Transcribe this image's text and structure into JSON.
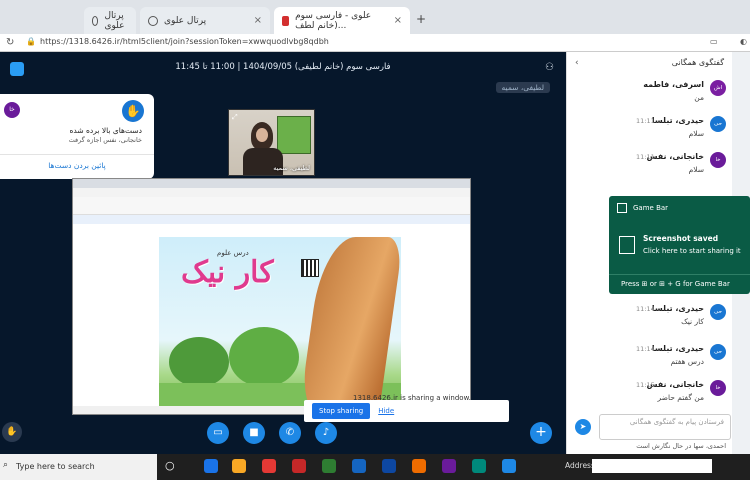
{
  "browser": {
    "tabs": [
      {
        "label": "پرتال علوی"
      },
      {
        "label": "پرتال علوی"
      },
      {
        "label": "علوی - فارسی سوم (خانم لطف..."
      }
    ],
    "url": "https://1318.6426.ir/html5client/join?sessionToken=xwwquodlvbg8qdbh"
  },
  "meeting": {
    "title": "فارسی سوم (خانم لطیفی) 1404/09/05 | 11:00 تا 11:45",
    "presenter_label": "لطیفی، سمیه",
    "hand_panel": {
      "avatar": "خا",
      "title": "دست‌های بالا برده شده",
      "subtitle": "خانجانی، نفس اجازه گرفت",
      "lower_button": "پائین بردن دست‌ها"
    },
    "webcam_name": "لطیفی، سمیه",
    "shared_window": {
      "page_title": "کار نیک",
      "page_subtitle": "درس علوم"
    },
    "sharing_bar": {
      "message": "1318.6426.ir is sharing a window.",
      "stop_label": "Stop sharing",
      "hide_label": "Hide"
    }
  },
  "chat": {
    "title": "گفتگوی همگانی",
    "messages": [
      {
        "avatar": "اش",
        "name": "اسرفی، فاطمه",
        "time": "",
        "text": "من",
        "color": "#7b1fa2"
      },
      {
        "avatar": "حی",
        "name": "حیدری، تبلسا",
        "time": "11:11",
        "text": "سلام",
        "color": "#1976d2"
      },
      {
        "avatar": "خا",
        "name": "خانجانی، نفس",
        "time": "11:11",
        "text": "سلام",
        "color": "#6a1b9a"
      },
      {
        "avatar": "حی",
        "name": "حیدری، تبلسا",
        "time": "11:14",
        "text": "کار نیک",
        "color": "#1976d2"
      },
      {
        "avatar": "حی",
        "name": "حیدری، تبلسا",
        "time": "11:14",
        "text": "درس هفتم",
        "color": "#1976d2"
      },
      {
        "avatar": "خا",
        "name": "خانجانی، نفس",
        "time": "11:15",
        "text": "من گفتم حاضر",
        "color": "#6a1b9a"
      }
    ],
    "input_placeholder": "فرستادن پیام به گفتگوی همگانی",
    "typing": "احمدی، سها در حال نگارش است"
  },
  "gamebar": {
    "title": "Game Bar",
    "saved": "Screenshot saved",
    "share": "Click here to start sharing it",
    "hint": "Press ⊞ or ⊞ + G for Game Bar"
  },
  "taskbar": {
    "search": "Type here to search",
    "address_label": "Address"
  }
}
